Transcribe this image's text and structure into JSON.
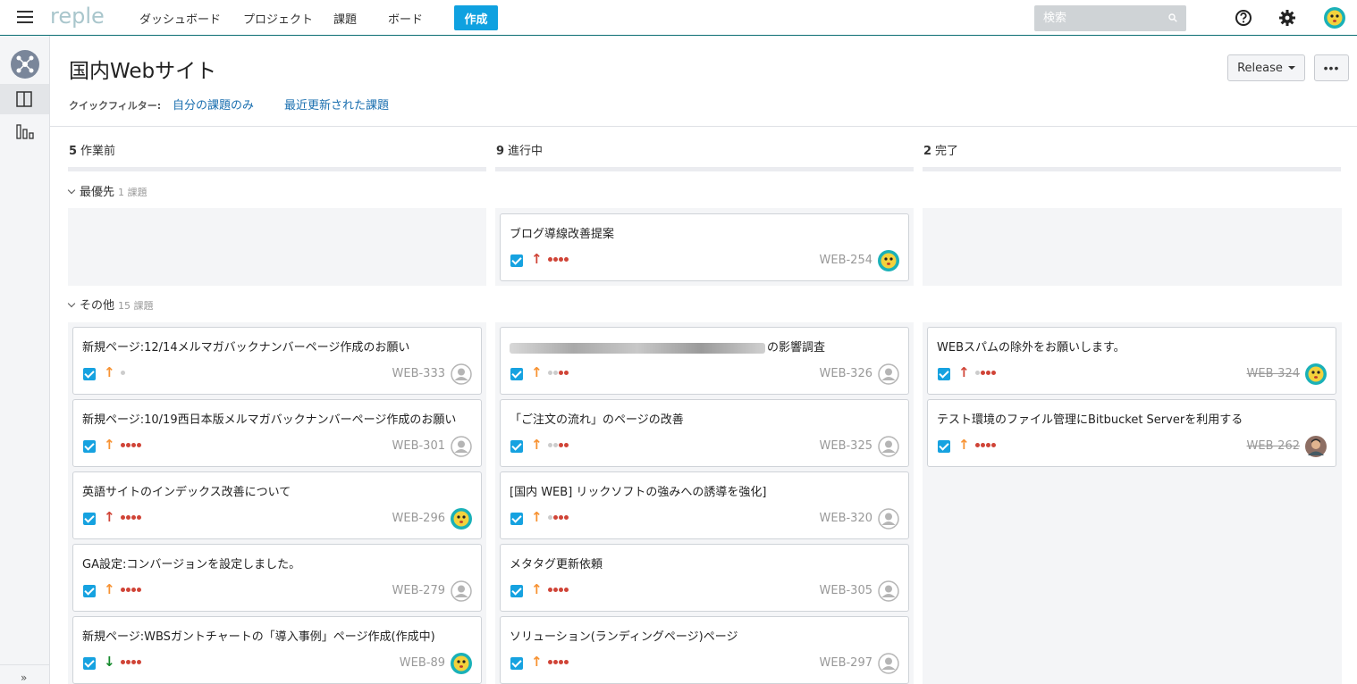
{
  "nav": {
    "logo": "reple",
    "items": [
      "ダッシュボード",
      "プロジェクト",
      "課題",
      "ボード"
    ],
    "create_label": "作成",
    "search_placeholder": "検索"
  },
  "page": {
    "title": "国内Webサイト",
    "release_label": "Release",
    "more_label": "•••",
    "quick_filter_label": "クイックフィルター:",
    "quick_filters": [
      "自分の課題のみ",
      "最近更新された課題"
    ]
  },
  "columns": [
    {
      "count": "5",
      "name": "作業前"
    },
    {
      "count": "9",
      "name": "進行中"
    },
    {
      "count": "2",
      "name": "完了"
    }
  ],
  "swimlanes": [
    {
      "name": "最優先",
      "count": "1 課題"
    },
    {
      "name": "その他",
      "count": "15 課題"
    }
  ],
  "colors": {
    "accent": "#0fa1e0",
    "prio_high": "#d04437",
    "prio_medium": "#f79232",
    "prio_low": "#14892c",
    "dot_red": "#d04437",
    "dot_gray": "#cccccc"
  },
  "cards": {
    "priority": [
      {
        "column": 1,
        "title": "ブログ導線改善提案",
        "key": "WEB-254",
        "priority": "up-red",
        "dots": [
          "r",
          "r",
          "r",
          "r"
        ],
        "avatar": "yellow-face",
        "done": false
      }
    ],
    "other": {
      "todo": [
        {
          "title": "新規ページ:12/14メルマガバックナンバーページ作成のお願い",
          "key": "WEB-333",
          "priority": "up-orange",
          "dots": [
            "g"
          ],
          "avatar": "default"
        },
        {
          "title": "新規ページ:10/19西日本版メルマガバックナンバーページ作成のお願い",
          "key": "WEB-301",
          "priority": "up-orange",
          "dots": [
            "r",
            "r",
            "r",
            "r"
          ],
          "avatar": "default"
        },
        {
          "title": "英語サイトのインデックス改善について",
          "key": "WEB-296",
          "priority": "up-red",
          "dots": [
            "r",
            "r",
            "r",
            "r"
          ],
          "avatar": "yellow-face"
        },
        {
          "title": "GA設定:コンバージョンを設定しました。",
          "key": "WEB-279",
          "priority": "up-orange",
          "dots": [
            "r",
            "r",
            "r",
            "r"
          ],
          "avatar": "default"
        },
        {
          "title": "新規ページ:WBSガントチャートの「導入事例」ページ作成(作成中)",
          "key": "WEB-89",
          "priority": "down-green",
          "dots": [
            "r",
            "r",
            "r",
            "r"
          ],
          "avatar": "yellow-face"
        }
      ],
      "progress": [
        {
          "title": "の影響調査",
          "blurred": true,
          "key": "WEB-326",
          "priority": "up-orange",
          "dots": [
            "g",
            "g",
            "r",
            "r"
          ],
          "avatar": "default"
        },
        {
          "title": "「ご注文の流れ」のページの改善",
          "key": "WEB-325",
          "priority": "up-orange",
          "dots": [
            "g",
            "g",
            "r",
            "r"
          ],
          "avatar": "default"
        },
        {
          "title": "[国内 WEB] リックソフトの強みへの誘導を強化]",
          "key": "WEB-320",
          "priority": "up-orange",
          "dots": [
            "g",
            "r",
            "r",
            "r"
          ],
          "avatar": "default"
        },
        {
          "title": "メタタグ更新依頼",
          "key": "WEB-305",
          "priority": "up-orange",
          "dots": [
            "r",
            "r",
            "r",
            "r"
          ],
          "avatar": "default"
        },
        {
          "title": "ソリューション(ランディングページ)ページ",
          "key": "WEB-297",
          "priority": "up-orange",
          "dots": [
            "r",
            "r",
            "r",
            "r"
          ],
          "avatar": "default"
        }
      ],
      "done": [
        {
          "title": "WEBスパムの除外をお願いします。",
          "key": "WEB-324",
          "priority": "up-red",
          "dots": [
            "g",
            "r",
            "r",
            "r"
          ],
          "avatar": "yellow-face"
        },
        {
          "title": "テスト環境のファイル管理にBitbucket Serverを利用する",
          "key": "WEB-262",
          "priority": "up-orange",
          "dots": [
            "r",
            "r",
            "r",
            "r"
          ],
          "avatar": "photo"
        }
      ]
    }
  }
}
